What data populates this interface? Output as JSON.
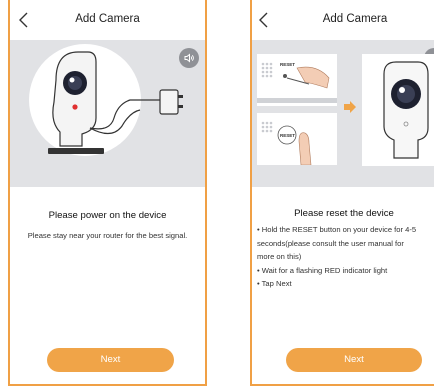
{
  "screens": [
    {
      "title": "Add Camera",
      "heading": "Please power on the device",
      "description": "Please stay near your router for the best signal.",
      "next_label": "Next"
    },
    {
      "title": "Add Camera",
      "heading": "Please reset the device",
      "reset_label": "RESET",
      "bullets": [
        "• Hold the RESET button on your device for 4-5",
        "seconds(please consult the user manual for",
        "more on this)",
        "• Wait for a flashing RED indicator light",
        "• Tap Next"
      ],
      "next_label": "Next"
    }
  ],
  "icons": {
    "back": "chevron-left-icon",
    "speaker": "speaker-icon",
    "arrow": "arrow-right-icon"
  },
  "colors": {
    "accent": "#f0a448",
    "border": "#f0a045",
    "illustration_bg": "#e1e2e5",
    "indicator": "#e03030"
  }
}
